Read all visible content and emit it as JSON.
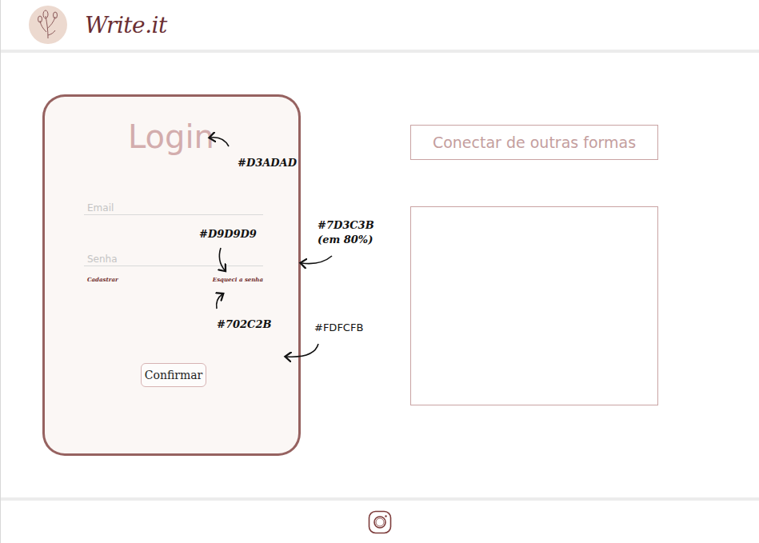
{
  "header": {
    "brand": "Write.it"
  },
  "login": {
    "title": "Login",
    "fields": [
      {
        "placeholder": "Email"
      },
      {
        "placeholder": "Senha"
      }
    ],
    "links": [
      "Cadastrar",
      "Esqueci a senha"
    ],
    "button": "Confirmar"
  },
  "other": {
    "title": "Conectar de outras formas"
  },
  "annotations": [
    {
      "lines": [
        "#D3ADAD"
      ],
      "kind": "bold"
    },
    {
      "lines": [
        "#D9D9D9"
      ],
      "kind": "bold"
    },
    {
      "lines": [
        "#7D3C3B",
        "(em 80%)"
      ],
      "kind": "bold"
    },
    {
      "lines": [
        "#702C2B"
      ],
      "kind": "bold"
    },
    {
      "lines": [
        "#FDFCFB"
      ],
      "kind": "plain"
    }
  ]
}
